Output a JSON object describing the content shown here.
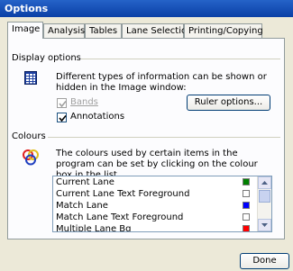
{
  "window": {
    "title": "Options"
  },
  "tabs": [
    {
      "label": "Image",
      "active": true
    },
    {
      "label": "Analysis",
      "active": false
    },
    {
      "label": "Tables",
      "active": false
    },
    {
      "label": "Lane Selection",
      "active": false
    },
    {
      "label": "Printing/Copying",
      "active": false
    }
  ],
  "display_options": {
    "heading": "Display options",
    "description": "Different types of information can be shown or hidden in the Image window:",
    "bands": {
      "label": "Bands",
      "checked": true,
      "enabled": false
    },
    "annotations": {
      "label": "Annotations",
      "checked": true,
      "enabled": true
    },
    "ruler_button": "Ruler options...",
    "icon": "grid-window-icon"
  },
  "colours": {
    "heading": "Colours",
    "description": "The colours used by certain items in the program can be set by clicking on the colour box in the list.",
    "icon": "color-circles-icon",
    "items": [
      {
        "label": "Current Lane",
        "color": "#008000"
      },
      {
        "label": "Current Lane Text Foreground",
        "color": "#ffffff"
      },
      {
        "label": "Match Lane",
        "color": "#0000ff"
      },
      {
        "label": "Match Lane Text Foreground",
        "color": "#ffffff"
      },
      {
        "label": "Multiple Lane Bg",
        "color": "#ff0000"
      }
    ]
  },
  "footer": {
    "done_button": "Done"
  }
}
